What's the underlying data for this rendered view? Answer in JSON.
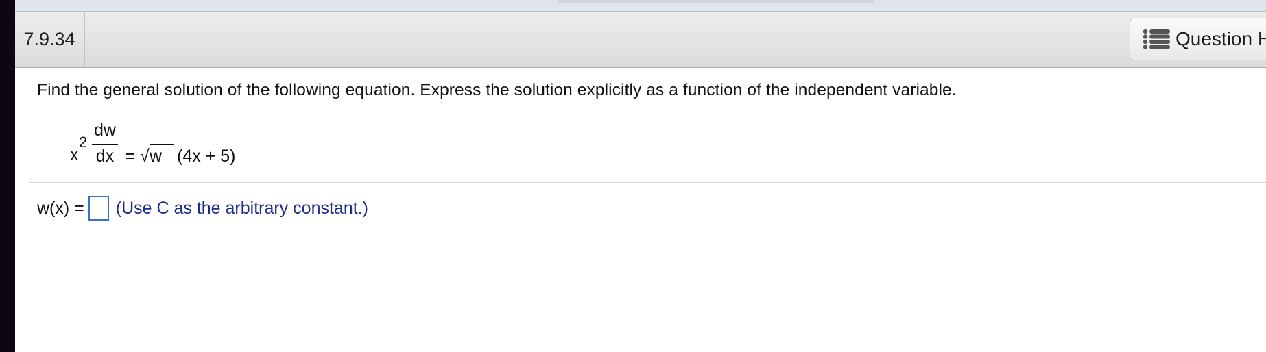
{
  "question_header": {
    "number": "7.9.34",
    "help_button_label": "Question H",
    "help_icon": "list-icon"
  },
  "question": {
    "instruction": "Find the general solution of the following equation. Express the solution explicitly as a function of the independent variable.",
    "equation": {
      "lhs_base": "x",
      "lhs_exponent": "2",
      "frac_numerator": "dw",
      "frac_denominator": "dx",
      "equals": "=",
      "sqrt_symbol": "√",
      "radicand": "w",
      "rhs_factor": "(4x + 5)"
    }
  },
  "answer": {
    "label": "w(x) =",
    "input_value": "",
    "hint": "(Use C as the arbitrary constant.)"
  },
  "colors": {
    "left_bar": "#0d0713",
    "input_border": "#3a70c8",
    "hint_text": "#1f2b8a"
  }
}
